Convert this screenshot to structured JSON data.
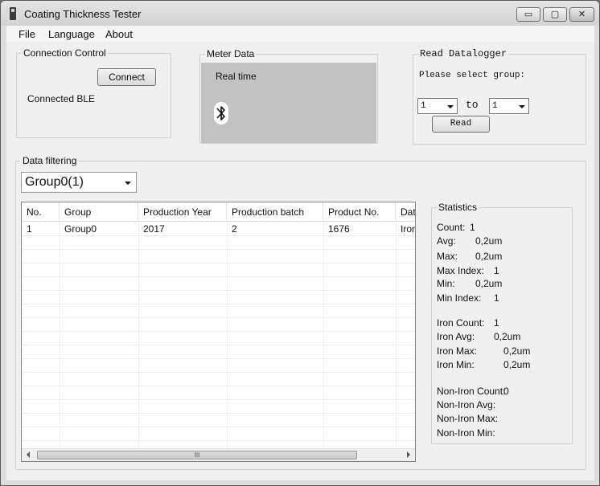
{
  "window": {
    "title": "Coating Thickness Tester",
    "min_glyph": "▭",
    "max_glyph": "▢",
    "close_glyph": "✕"
  },
  "menu": {
    "file": "File",
    "language": "Language",
    "about": "About"
  },
  "connection": {
    "group_label": "Connection Control",
    "connect_button": "Connect",
    "status": "Connected BLE"
  },
  "meter": {
    "group_label": "Meter Data",
    "mode": "Real time",
    "icon": "bluetooth-icon"
  },
  "datalogger": {
    "group_label": "Read Datalogger",
    "prompt": "Please select group:",
    "from_value": "1",
    "to_label": "to",
    "to_value": "1",
    "read_button": "Read"
  },
  "filtering": {
    "group_label": "Data filtering",
    "selected_group": "Group0(1)"
  },
  "table": {
    "columns": [
      "No.",
      "Group",
      "Production Year",
      "Production batch",
      "Product No.",
      "Data"
    ],
    "rows": [
      [
        "1",
        "Group0",
        "2017",
        "2",
        "1676",
        "Iron"
      ]
    ],
    "scroll_grip": "III"
  },
  "statistics": {
    "group_label": "Statistics",
    "count_label": "Count:",
    "count": "1",
    "avg_label": "Avg:",
    "avg": "0,2um",
    "max_label": "Max:",
    "max": "0,2um",
    "max_index_label": "Max Index:",
    "max_index": "1",
    "min_label": "Min:",
    "min": "0,2um",
    "min_index_label": "Min Index:",
    "min_index": "1",
    "iron_count_label": "Iron Count:",
    "iron_count": "1",
    "iron_avg_label": "Iron Avg:",
    "iron_avg": "0,2um",
    "iron_max_label": "Iron Max:",
    "iron_max": "0,2um",
    "iron_min_label": "Iron Min:",
    "iron_min": "0,2um",
    "noniron_count_label": "Non-Iron Count:",
    "noniron_count": "0",
    "noniron_avg_label": "Non-Iron Avg:",
    "noniron_max_label": "Non-Iron Max:",
    "noniron_min_label": "Non-Iron Min:"
  }
}
